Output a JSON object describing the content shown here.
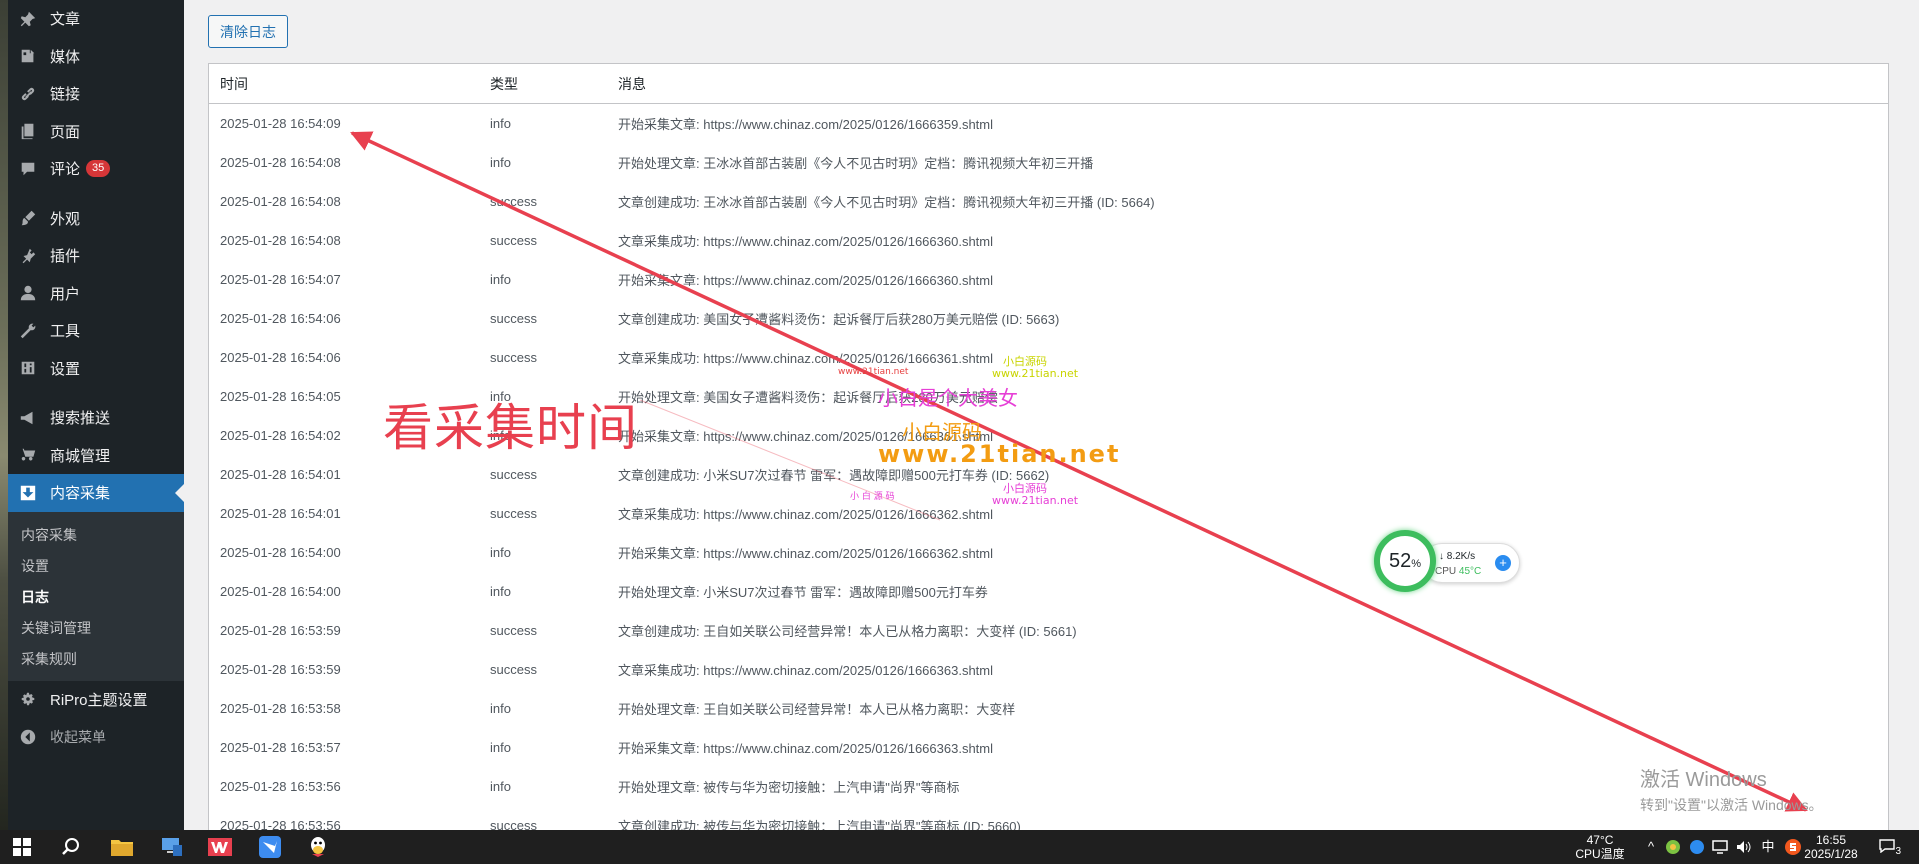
{
  "sidebar": {
    "items": [
      {
        "label": "文章",
        "icon": "pin-icon"
      },
      {
        "label": "媒体",
        "icon": "media-icon"
      },
      {
        "label": "链接",
        "icon": "link-icon"
      },
      {
        "label": "页面",
        "icon": "page-icon"
      },
      {
        "label": "评论",
        "icon": "comment-icon",
        "badge": "35"
      },
      {
        "label": "外观",
        "icon": "brush-icon"
      },
      {
        "label": "插件",
        "icon": "plugin-icon"
      },
      {
        "label": "用户",
        "icon": "user-icon"
      },
      {
        "label": "工具",
        "icon": "wrench-icon"
      },
      {
        "label": "设置",
        "icon": "settings-icon"
      },
      {
        "label": "搜索推送",
        "icon": "megaphone-icon"
      },
      {
        "label": "商城管理",
        "icon": "cart-icon"
      },
      {
        "label": "内容采集",
        "icon": "download-icon",
        "active": true
      }
    ],
    "submenu": [
      "内容采集",
      "设置",
      "日志",
      "关键词管理",
      "采集规则"
    ],
    "submenu_current": "日志",
    "theme_settings": "RiPro主题设置",
    "collapse": "收起菜单"
  },
  "toolbar": {
    "clear_label": "清除日志"
  },
  "table": {
    "headers": [
      "时间",
      "类型",
      "消息"
    ],
    "rows": [
      [
        "2025-01-28 16:54:09",
        "info",
        "开始采集文章: https://www.chinaz.com/2025/0126/1666359.shtml"
      ],
      [
        "2025-01-28 16:54:08",
        "info",
        "开始处理文章: 王冰冰首部古装剧《今人不见古时玥》定档：腾讯视频大年初三开播"
      ],
      [
        "2025-01-28 16:54:08",
        "success",
        "文章创建成功: 王冰冰首部古装剧《今人不见古时玥》定档：腾讯视频大年初三开播 (ID: 5664)"
      ],
      [
        "2025-01-28 16:54:08",
        "success",
        "文章采集成功: https://www.chinaz.com/2025/0126/1666360.shtml"
      ],
      [
        "2025-01-28 16:54:07",
        "info",
        "开始采集文章: https://www.chinaz.com/2025/0126/1666360.shtml"
      ],
      [
        "2025-01-28 16:54:06",
        "success",
        "文章创建成功: 美国女子遭酱料烫伤：起诉餐厅后获280万美元赔偿 (ID: 5663)"
      ],
      [
        "2025-01-28 16:54:06",
        "success",
        "文章采集成功: https://www.chinaz.com/2025/0126/1666361.shtml"
      ],
      [
        "2025-01-28 16:54:05",
        "info",
        "开始处理文章: 美国女子遭酱料烫伤：起诉餐厅后获280万美元赔偿"
      ],
      [
        "2025-01-28 16:54:02",
        "info",
        "开始采集文章: https://www.chinaz.com/2025/0126/1666361.shtml"
      ],
      [
        "2025-01-28 16:54:01",
        "success",
        "文章创建成功: 小米SU7次过春节 雷军：遇故障即赠500元打车券 (ID: 5662)"
      ],
      [
        "2025-01-28 16:54:01",
        "success",
        "文章采集成功: https://www.chinaz.com/2025/0126/1666362.shtml"
      ],
      [
        "2025-01-28 16:54:00",
        "info",
        "开始采集文章: https://www.chinaz.com/2025/0126/1666362.shtml"
      ],
      [
        "2025-01-28 16:54:00",
        "info",
        "开始处理文章: 小米SU7次过春节 雷军：遇故障即赠500元打车券"
      ],
      [
        "2025-01-28 16:53:59",
        "success",
        "文章创建成功: 王自如关联公司经营异常！本人已从格力离职：大变样 (ID: 5661)"
      ],
      [
        "2025-01-28 16:53:59",
        "success",
        "文章采集成功: https://www.chinaz.com/2025/0126/1666363.shtml"
      ],
      [
        "2025-01-28 16:53:58",
        "info",
        "开始处理文章: 王自如关联公司经营异常！本人已从格力离职：大变样"
      ],
      [
        "2025-01-28 16:53:57",
        "info",
        "开始采集文章: https://www.chinaz.com/2025/0126/1666363.shtml"
      ],
      [
        "2025-01-28 16:53:56",
        "info",
        "开始处理文章: 被传与华为密切接触：上汽申请\"尚界\"等商标"
      ],
      [
        "2025-01-28 16:53:56",
        "success",
        "文章创建成功: 被传与华为密切接触：上汽申请\"尚界\"等商标 (ID: 5660)"
      ]
    ]
  },
  "annotation": {
    "text": "看采集时间",
    "color": "#e8404f"
  },
  "watermarks": {
    "line1": "小白是个大美女",
    "line2": "小白源码",
    "line3": "www.21tian.net",
    "small_a": "小白源码",
    "small_b": "www.21tian.net",
    "small_c": "小白源码",
    "small_d": "www.21tian.net",
    "small_e": "小 白 源 码",
    "small_f": "www.21tian.net"
  },
  "net_widget": {
    "percent": "52",
    "percent_unit": "%",
    "speed": "8.2K/s",
    "cpu_label": "CPU",
    "cpu_temp": "45°C",
    "plus": "+"
  },
  "activate_windows": {
    "title": "激活 Windows",
    "subtitle": "转到\"设置\"以激活 Windows。"
  },
  "taskbar": {
    "cpu_temp": "47°C",
    "cpu_label": "CPU温度",
    "ime": "中",
    "time": "16:55",
    "date": "2025/1/28",
    "notif_count": "3"
  },
  "colors": {
    "sidebar_bg": "#1d2327",
    "active_bg": "#2271b1",
    "badge": "#d63638",
    "arrow": "#e8404f",
    "widget_green": "#3dbd5e"
  }
}
